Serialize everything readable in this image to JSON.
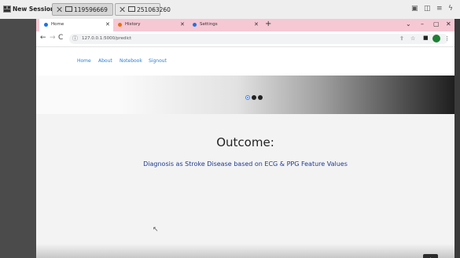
{
  "session": {
    "title": "New Session",
    "tabs": [
      {
        "label": "119596669",
        "active": true
      },
      {
        "label": "251063260",
        "active": false
      }
    ],
    "controls": [
      "pin-icon",
      "screenshot-icon",
      "menu-icon",
      "lightning-icon"
    ]
  },
  "browser": {
    "tabs": [
      {
        "label": "Home",
        "active": true,
        "favicon_color": "#1a73e8"
      },
      {
        "label": "History",
        "active": false,
        "favicon_color": "#e8710a"
      },
      {
        "label": "Settings",
        "active": false,
        "favicon_color": "#1a73e8"
      }
    ],
    "url": "127.0.0.1:5000/predict",
    "window_controls": [
      "chevron-down-icon",
      "minimize-icon",
      "maximize-icon",
      "close-icon"
    ]
  },
  "page": {
    "nav": [
      "Home",
      "About",
      "Notebook",
      "Signout"
    ],
    "carousel": {
      "slides": 3,
      "active_index": 0
    },
    "outcome_title": "Outcome:",
    "outcome_text": "Diagnosis as Stroke Disease based on ECG & PPG Feature Values"
  },
  "colors": {
    "tabstrip": "#f6c8d4",
    "link": "#2a7fd4",
    "outcome_text": "#1f3a8f",
    "scroll_button": "#2b2b2b"
  }
}
